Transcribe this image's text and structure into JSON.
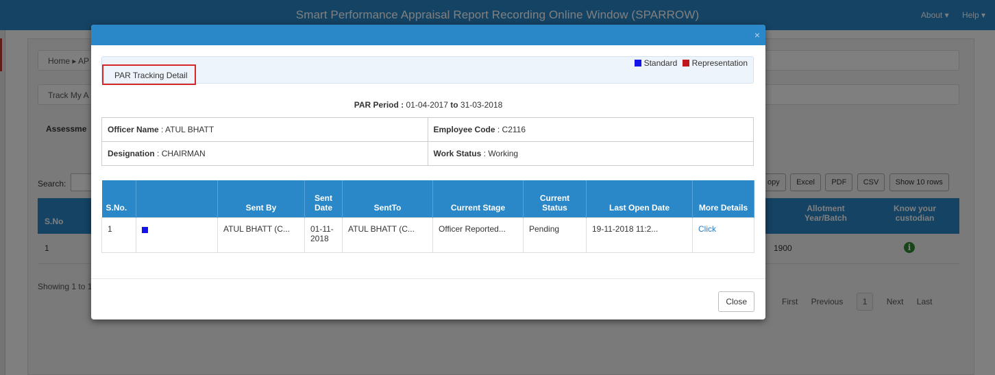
{
  "app": {
    "title": "Smart Performance Appraisal Report Recording Online Window (SPARROW)",
    "nav_about": "About ▾",
    "nav_help": "Help ▾"
  },
  "background": {
    "breadcrumb": "Home ▸ AP",
    "track_bar": "Track My A",
    "assessment_label": "Assessme",
    "search_label": "Search:",
    "export_buttons": [
      "opy",
      "Excel",
      "PDF",
      "CSV",
      "Show 10 rows"
    ],
    "headers": {
      "sno": "S.No",
      "allotment": "Allotment Year/Batch",
      "custodian": "Know your custodian"
    },
    "row": {
      "sno": "1",
      "allotment": "1900"
    },
    "showing": "Showing 1 to 1",
    "pager": {
      "first": "First",
      "previous": "Previous",
      "current": "1",
      "next": "Next",
      "last": "Last"
    }
  },
  "modal": {
    "close_x": "×",
    "tracking_title": "PAR Tracking Detail",
    "legend": [
      {
        "label": "Standard",
        "color": "#1414e8"
      },
      {
        "label": "Representation",
        "color": "#c0161b"
      }
    ],
    "period_label": "PAR Period :",
    "period_from": "01-04-2017",
    "period_to_word": "to",
    "period_to": "31-03-2018",
    "officer": {
      "name_label": "Officer Name",
      "name": "ATUL BHATT",
      "code_label": "Employee Code",
      "code": "C2116",
      "designation_label": "Designation",
      "designation": "CHAIRMAN",
      "status_label": "Work Status",
      "status": "Working"
    },
    "columns": [
      "S.No.",
      "",
      "Sent By",
      "Sent Date",
      "SentTo",
      "Current Stage",
      "Current Status",
      "Last Open Date",
      "More Details"
    ],
    "rows": [
      {
        "sno": "1",
        "sent_by": "ATUL BHATT (C...",
        "sent_date_1": "01-11-",
        "sent_date_2": "2018",
        "sent_to": "ATUL BHATT (C...",
        "stage": "Officer Reported...",
        "status": "Pending",
        "last_open": "19-11-2018 11:2...",
        "more": "Click"
      }
    ],
    "close_button": "Close"
  }
}
